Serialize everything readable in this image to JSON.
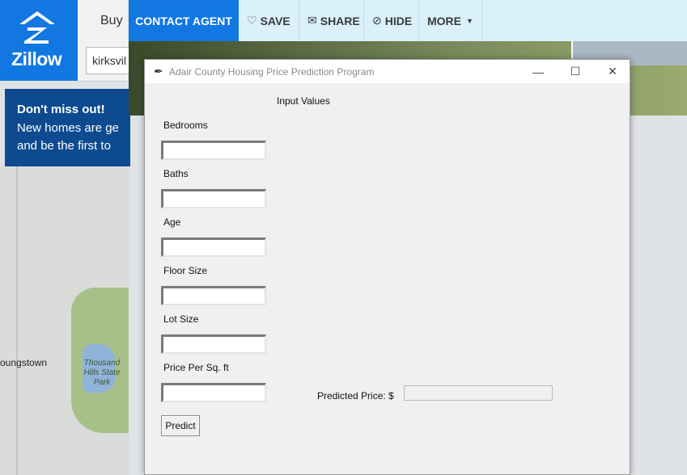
{
  "zillow": {
    "logo_text": "Zillow",
    "nav_buy": "Buy",
    "search_value": "kirksvil",
    "promo_line1": "Don't miss out!",
    "promo_line2": "New homes are ge",
    "promo_line3": "and be the first to",
    "map_town": "oungstown",
    "map_park": "Thousand Hills State Park"
  },
  "listing_actions": {
    "contact": "CONTACT AGENT",
    "save": "SAVE",
    "share": "SHARE",
    "hide": "HIDE",
    "more": "MORE"
  },
  "app_window": {
    "title": "Adair County Housing Price Prediction Program",
    "section_heading": "Input Values",
    "fields": [
      {
        "label": "Bedrooms",
        "value": ""
      },
      {
        "label": "Baths",
        "value": ""
      },
      {
        "label": "Age",
        "value": ""
      },
      {
        "label": "Floor Size",
        "value": ""
      },
      {
        "label": "Lot Size",
        "value": ""
      },
      {
        "label": "Price Per Sq. ft",
        "value": ""
      }
    ],
    "predicted_label": "Predicted Price: $",
    "predicted_value": "",
    "predict_button": "Predict",
    "minimize_glyph": "—",
    "maximize_glyph": "☐",
    "close_glyph": "✕"
  },
  "colors": {
    "zillow_blue": "#1277e1",
    "promo_navy": "#0d4a8f",
    "actionbar_bg": "#daf0fb",
    "window_bg": "#f0f0f0"
  }
}
